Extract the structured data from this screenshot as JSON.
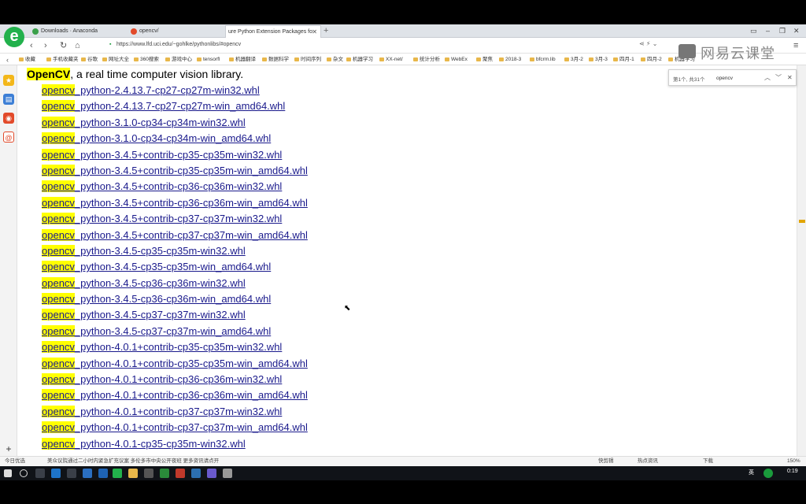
{
  "browser": {
    "logo_glyph": "e",
    "tabs": [
      {
        "label": "Downloads · Anaconda",
        "active": false,
        "icon_color": "#3aa04a"
      },
      {
        "label": "opencv/",
        "active": false,
        "icon_color": "#e24a2a"
      },
      {
        "label": "ure Python Extension Packages fo",
        "active": true,
        "icon_color": "#888888"
      }
    ],
    "new_tab_glyph": "+",
    "window_controls": [
      "▭",
      "–",
      "❐",
      "✕"
    ],
    "url": "https://www.lfd.uci.edu/~gohlke/pythonlibs/#opencv",
    "watermark": "网易云课堂"
  },
  "bookmarks": [
    "收藏",
    "手机收藏夹",
    "谷歌",
    "网址大全",
    "360搜索",
    "游戏中心",
    "tensorfl",
    "机器翻译",
    "数据科学",
    "时间序列",
    "杂文",
    "机器学习",
    "XX-net/",
    "统计分析",
    "WebEx",
    "聚焦",
    "2018-3",
    "bfcrm.lib",
    "3月-2",
    "3月-3",
    "四月-1",
    "四月-2",
    "机器学习"
  ],
  "find_bar": {
    "count": "第1个, 共31个",
    "query": "opencv"
  },
  "page": {
    "library_name": "OpenCV",
    "library_desc": ", a real time computer vision library.",
    "highlight_prefix": "opencv",
    "files": [
      "_python-2.4.13.7-cp27-cp27m-win32.whl",
      "_python-2.4.13.7-cp27-cp27m-win_amd64.whl",
      "_python-3.1.0-cp34-cp34m-win32.whl",
      "_python-3.1.0-cp34-cp34m-win_amd64.whl",
      "_python-3.4.5+contrib-cp35-cp35m-win32.whl",
      "_python-3.4.5+contrib-cp35-cp35m-win_amd64.whl",
      "_python-3.4.5+contrib-cp36-cp36m-win32.whl",
      "_python-3.4.5+contrib-cp36-cp36m-win_amd64.whl",
      "_python-3.4.5+contrib-cp37-cp37m-win32.whl",
      "_python-3.4.5+contrib-cp37-cp37m-win_amd64.whl",
      "_python-3.4.5-cp35-cp35m-win32.whl",
      "_python-3.4.5-cp35-cp35m-win_amd64.whl",
      "_python-3.4.5-cp36-cp36m-win32.whl",
      "_python-3.4.5-cp36-cp36m-win_amd64.whl",
      "_python-3.4.5-cp37-cp37m-win32.whl",
      "_python-3.4.5-cp37-cp37m-win_amd64.whl",
      "_python-4.0.1+contrib-cp35-cp35m-win32.whl",
      "_python-4.0.1+contrib-cp35-cp35m-win_amd64.whl",
      "_python-4.0.1+contrib-cp36-cp36m-win32.whl",
      "_python-4.0.1+contrib-cp36-cp36m-win_amd64.whl",
      "_python-4.0.1+contrib-cp37-cp37m-win32.whl",
      "_python-4.0.1+contrib-cp37-cp37m-win_amd64.whl",
      "_python-4.0.1-cp35-cp35m-win32.whl"
    ]
  },
  "status_bar": {
    "left": "今日优选",
    "news": "美众议院通过二小时内紧急扩充议案 多伦多市中央公开夜班 更多资讯请点开",
    "items": [
      "快剪辑",
      "热点资讯",
      "下载",
      "150%"
    ]
  },
  "taskbar": {
    "lang": "英",
    "time": "0:19"
  },
  "colors": {
    "highlight": "#ffff00",
    "link": "#1a1a8c",
    "logo": "#22b14c",
    "scroll_mark": "#e2a500"
  }
}
